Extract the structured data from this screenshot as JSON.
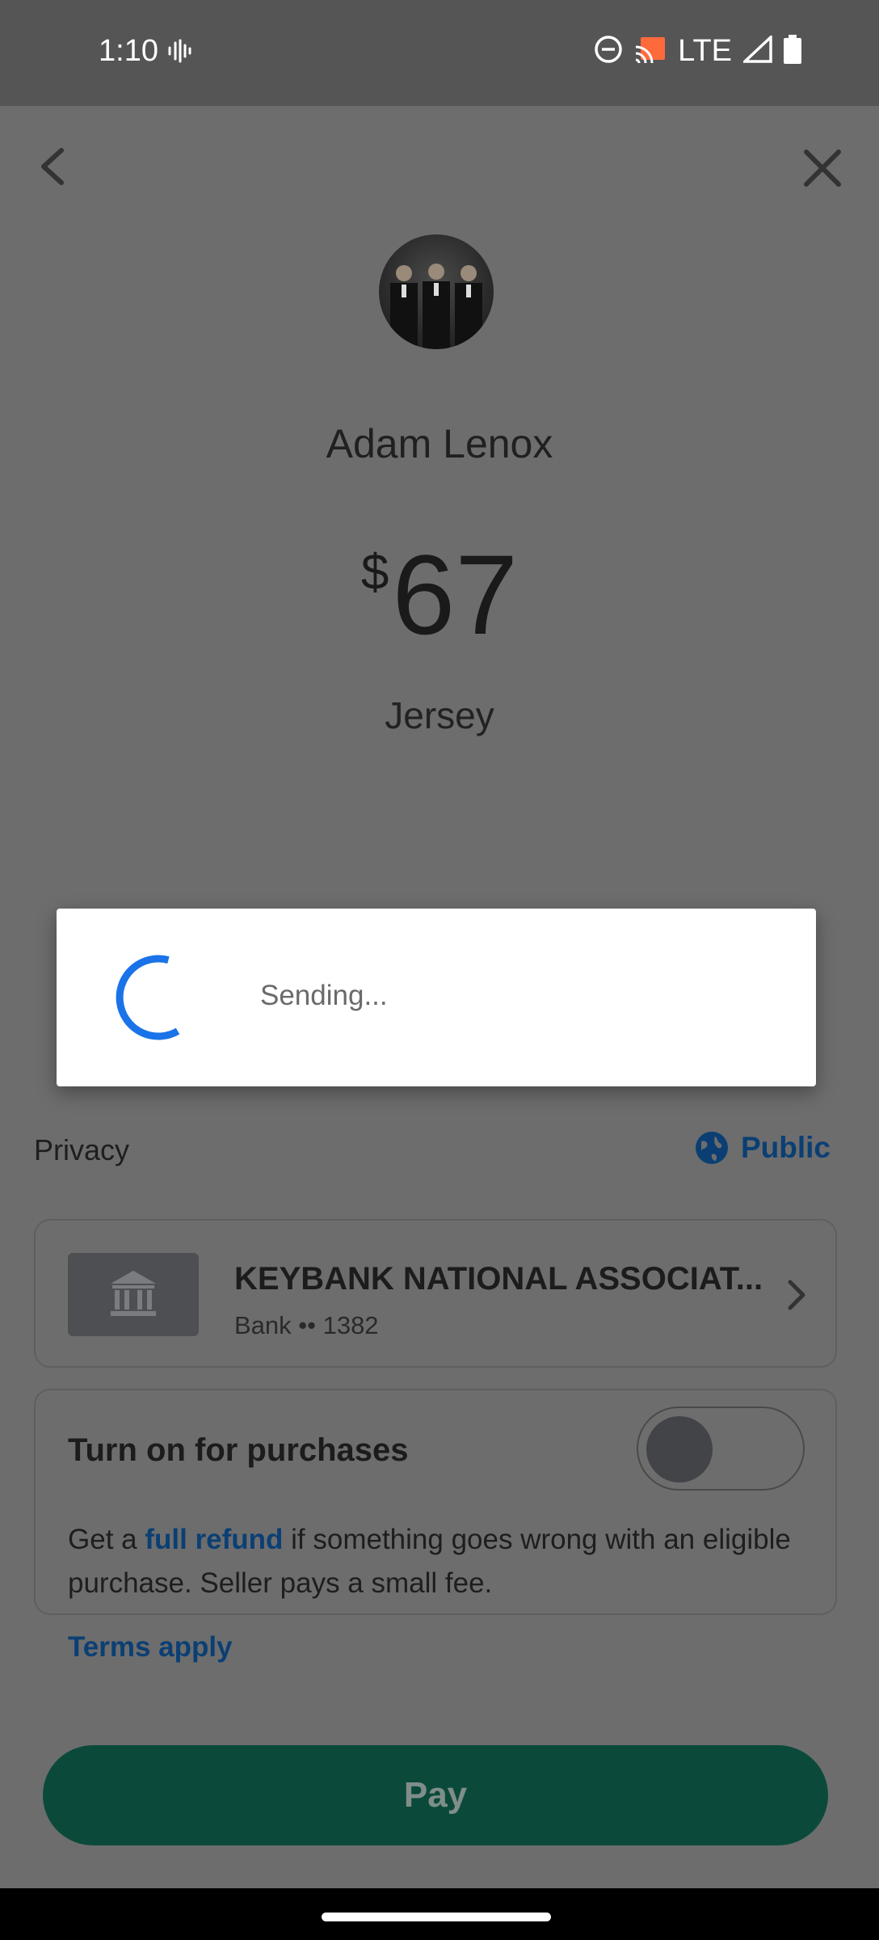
{
  "status_bar": {
    "time": "1:10",
    "network": "LTE"
  },
  "recipient": {
    "name": "Adam Lenox"
  },
  "payment": {
    "currency_symbol": "$",
    "amount": "67",
    "note": "Jersey"
  },
  "privacy": {
    "label": "Privacy",
    "value": "Public"
  },
  "funding_source": {
    "name": "KEYBANK NATIONAL ASSOCIAT...",
    "detail": "Bank •• 1382"
  },
  "purchase_protection": {
    "title": "Turn on for purchases",
    "toggle_on": false,
    "desc_prefix": "Get a ",
    "desc_link": "full refund",
    "desc_suffix": " if something goes wrong with an eligible purchase. Seller pays a small fee.",
    "terms_link": "Terms apply"
  },
  "pay_button_label": "Pay",
  "dialog": {
    "message": "Sending..."
  },
  "colors": {
    "accent_blue": "#0b3f74",
    "spinner_blue": "#1a73e8",
    "pay_green": "#0b4a3b"
  }
}
